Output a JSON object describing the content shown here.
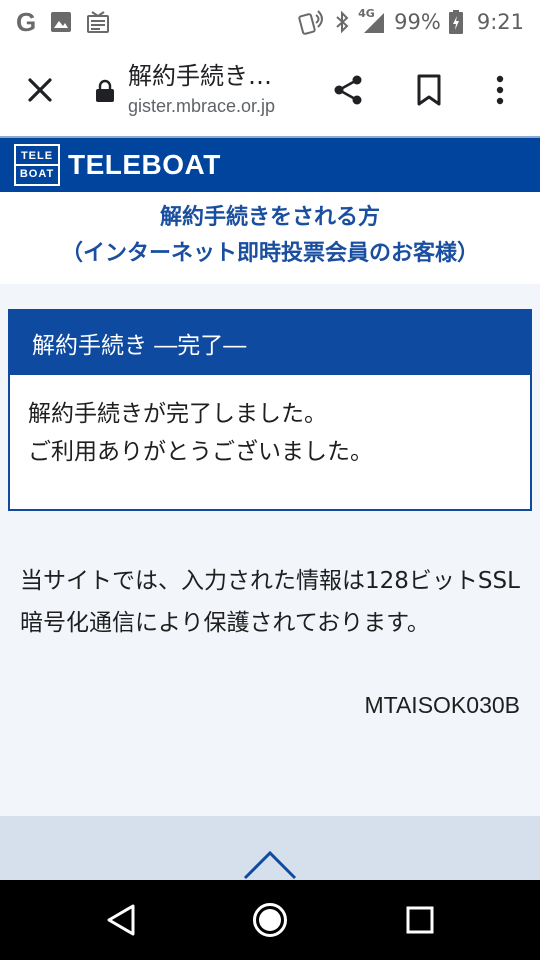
{
  "status_bar": {
    "time": "9:21",
    "battery": "99%",
    "network": "4G",
    "icons": [
      "google-icon",
      "image-icon",
      "news-icon",
      "nfc-icon",
      "bluetooth-icon",
      "signal-icon",
      "battery-icon"
    ]
  },
  "browser": {
    "page_title": "解約手続き…",
    "url": "gister.mbrace.or.jp",
    "icons": [
      "close-icon",
      "lock-icon",
      "share-icon",
      "bookmark-icon",
      "more-menu-icon"
    ]
  },
  "brand": {
    "logo_top": "TELE",
    "logo_bottom": "BOAT",
    "name": "TELEBOAT",
    "color": "#00449e"
  },
  "header": {
    "line1": "解約手続きをされる方",
    "line2": "（インターネット即時投票会員のお客様）",
    "color": "#1a4fa0"
  },
  "panel": {
    "title": "解約手続き ―完了―",
    "message_line1": "解約手続きが完了しました。",
    "message_line2": "ご利用ありがとうございました。"
  },
  "note": {
    "text": "当サイトでは、入力された情報は128ビットSSL暗号化通信により保護されております。"
  },
  "screen_id": "MTAISOK030B",
  "nav_bar": {
    "icons": [
      "back-icon",
      "home-icon",
      "recent-apps-icon"
    ]
  }
}
